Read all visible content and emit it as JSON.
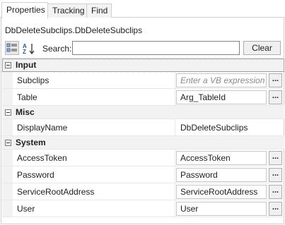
{
  "tabs": [
    {
      "label": "Properties",
      "active": true
    },
    {
      "label": "Tracking",
      "active": false
    },
    {
      "label": "Find",
      "active": false
    }
  ],
  "subject": "DbDeleteSubclips.DbDeleteSubclips",
  "toolbar": {
    "categorized_icon": "categorized-view-icon",
    "alphabetical_icon": "sort-alphabetical-icon",
    "search_label": "Search:",
    "search_value": "",
    "clear_label": "Clear"
  },
  "categories": [
    {
      "name": "Input",
      "properties": [
        {
          "name": "Subclips",
          "value": "Enter a VB expression",
          "placeholder": true
        },
        {
          "name": "Table",
          "value": "Arg_TableId",
          "placeholder": false
        }
      ]
    },
    {
      "name": "Misc",
      "properties": [
        {
          "name": "DisplayName",
          "value": "DbDeleteSubclips",
          "placeholder": false
        }
      ]
    },
    {
      "name": "System",
      "properties": [
        {
          "name": "AccessToken",
          "value": "AccessToken",
          "placeholder": false
        },
        {
          "name": "Password",
          "value": "Password",
          "placeholder": false
        },
        {
          "name": "ServiceRootAddress",
          "value": "ServiceRootAddress",
          "placeholder": false
        },
        {
          "name": "User",
          "value": "User",
          "placeholder": false
        }
      ]
    }
  ],
  "ellipsis_label": "...",
  "colors": {
    "category_bg": "#f2f2f2",
    "border": "#cfcfcf",
    "placeholder_text": "#8a8a8a"
  }
}
